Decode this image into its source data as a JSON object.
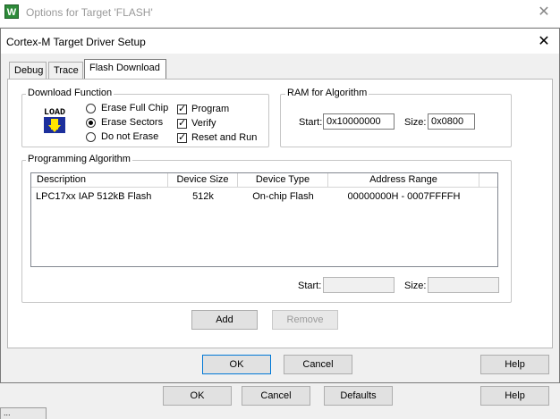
{
  "outer_window": {
    "icon_letter": "W",
    "title": "Options for Target 'FLASH'",
    "close": "✕",
    "buttons": {
      "ok": "OK",
      "cancel": "Cancel",
      "defaults": "Defaults",
      "help": "Help"
    },
    "bottom_tab": "..."
  },
  "dialog": {
    "title": "Cortex-M Target Driver Setup",
    "close": "✕",
    "tabs": [
      {
        "label": "Debug",
        "active": false
      },
      {
        "label": "Trace",
        "active": false
      },
      {
        "label": "Flash Download",
        "active": true
      }
    ],
    "download_function": {
      "label": "Download Function",
      "icon_text": "LOAD",
      "radios": [
        {
          "label": "Erase Full Chip",
          "checked": false
        },
        {
          "label": "Erase Sectors",
          "checked": true
        },
        {
          "label": "Do not Erase",
          "checked": false
        }
      ],
      "checks": [
        {
          "label": "Program",
          "checked": true
        },
        {
          "label": "Verify",
          "checked": true
        },
        {
          "label": "Reset and Run",
          "checked": true
        }
      ]
    },
    "ram_for_algorithm": {
      "label": "RAM for Algorithm",
      "start_label": "Start:",
      "start_value": "0x10000000",
      "size_label": "Size:",
      "size_value": "0x0800"
    },
    "programming_algorithm": {
      "label": "Programming Algorithm",
      "columns": [
        "Description",
        "Device Size",
        "Device Type",
        "Address Range"
      ],
      "rows": [
        {
          "description": "LPC17xx IAP 512kB Flash",
          "device_size": "512k",
          "device_type": "On-chip Flash",
          "address_range": "00000000H - 0007FFFFH"
        }
      ],
      "start_label": "Start:",
      "start_value": "",
      "size_label": "Size:",
      "size_value": ""
    },
    "buttons": {
      "add": "Add",
      "remove": "Remove",
      "ok": "OK",
      "cancel": "Cancel",
      "help": "Help"
    }
  }
}
